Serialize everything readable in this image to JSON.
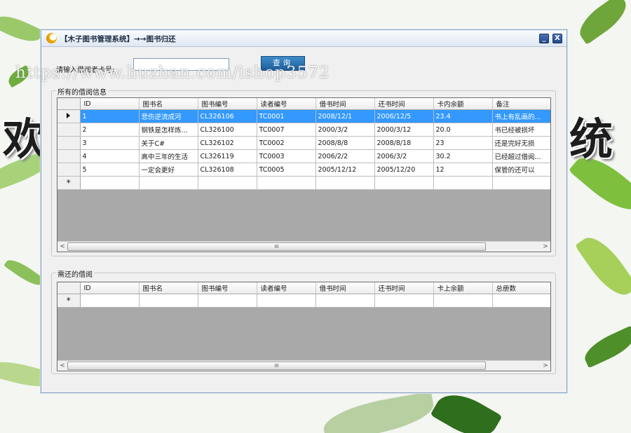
{
  "window": {
    "title": "【木子图书管理系统】→→图书归还"
  },
  "search": {
    "label": "请输入借阅者卡号:",
    "value": "",
    "button_label": "查询"
  },
  "borrowed_group": {
    "title": "所有的借阅信息",
    "columns": [
      "ID",
      "图书名",
      "图书编号",
      "读者编号",
      "借书时间",
      "还书时间",
      "卡内余额",
      "备注"
    ],
    "rows": [
      [
        "1",
        "悲伤逆流成河",
        "CL326106",
        "TC0001",
        "2008/12/1",
        "2006/12/5",
        "23.4",
        "书上有乱画的..."
      ],
      [
        "2",
        "钢铁是怎样炼...",
        "CL326100",
        "TC0007",
        "2000/3/2",
        "2000/3/12",
        "20.0",
        "书已经被损坏"
      ],
      [
        "3",
        "关于C#",
        "CL326102",
        "TC0002",
        "2008/8/8",
        "2008/8/18",
        "23",
        "还是完好无损"
      ],
      [
        "4",
        "高中三年的生活",
        "CL326119",
        "TC0003",
        "2006/2/2",
        "2006/3/2",
        "30.2",
        "已经超过借阅..."
      ],
      [
        "5",
        "一定会更好",
        "CL326108",
        "TC0005",
        "2005/12/12",
        "2005/12/20",
        "12",
        "保管的还可以"
      ]
    ],
    "new_row_marker": "*"
  },
  "return_group": {
    "title": "需还的借阅",
    "columns": [
      "ID",
      "图书名",
      "图书编号",
      "读者编号",
      "借书时间",
      "还书时间",
      "卡上余额",
      "总册数"
    ],
    "new_row_marker": "*"
  },
  "scrollbar": {
    "left_arrow": "<",
    "right_arrow": ">",
    "thumb_grip": "III"
  },
  "title_buttons": {
    "minimize": "_",
    "close": "X"
  },
  "background_text": {
    "left": "欢",
    "right": "统"
  },
  "watermark": "https://www.huzhan.com/ishop3572",
  "colors": {
    "selected_row": "#3399ff",
    "query_button": "#2a6fb0",
    "grid_empty_area": "#a9a9a9"
  }
}
